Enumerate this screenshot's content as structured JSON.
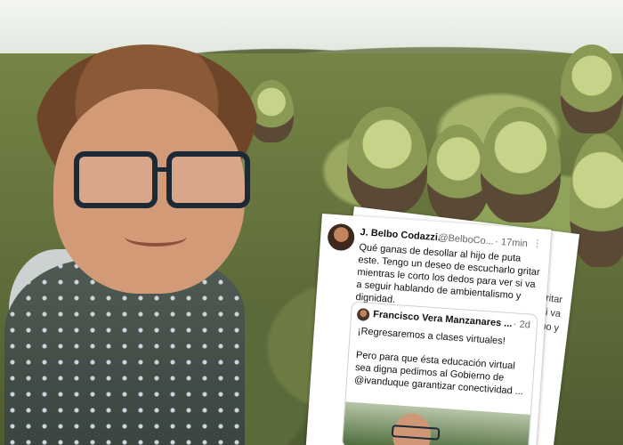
{
  "tweet": {
    "author_name": "J. Belbo Codazzi.",
    "author_handle": "@BelboCo...",
    "time_ago": "· 17min",
    "menu_glyph": "⋮",
    "text": "Qué ganas de desollar al hijo de puta este. Tengo un deseo de escucharlo gritar mientras le corto los dedos para ver si va a seguir hablando de ambientalismo y dignidad.",
    "quoted": {
      "author_name": "Francisco Vera Manzanares ...",
      "time_ago": "· 2d",
      "line1": "¡Regresaremos a clases virtuales!",
      "body": "Pero para que ésta educación virtual sea digna pedimos al Gobierno de @ivanduque garantizar conectividad ..."
    }
  },
  "back_card_fragments": [
    "gritar",
    "i va",
    "mo y"
  ]
}
